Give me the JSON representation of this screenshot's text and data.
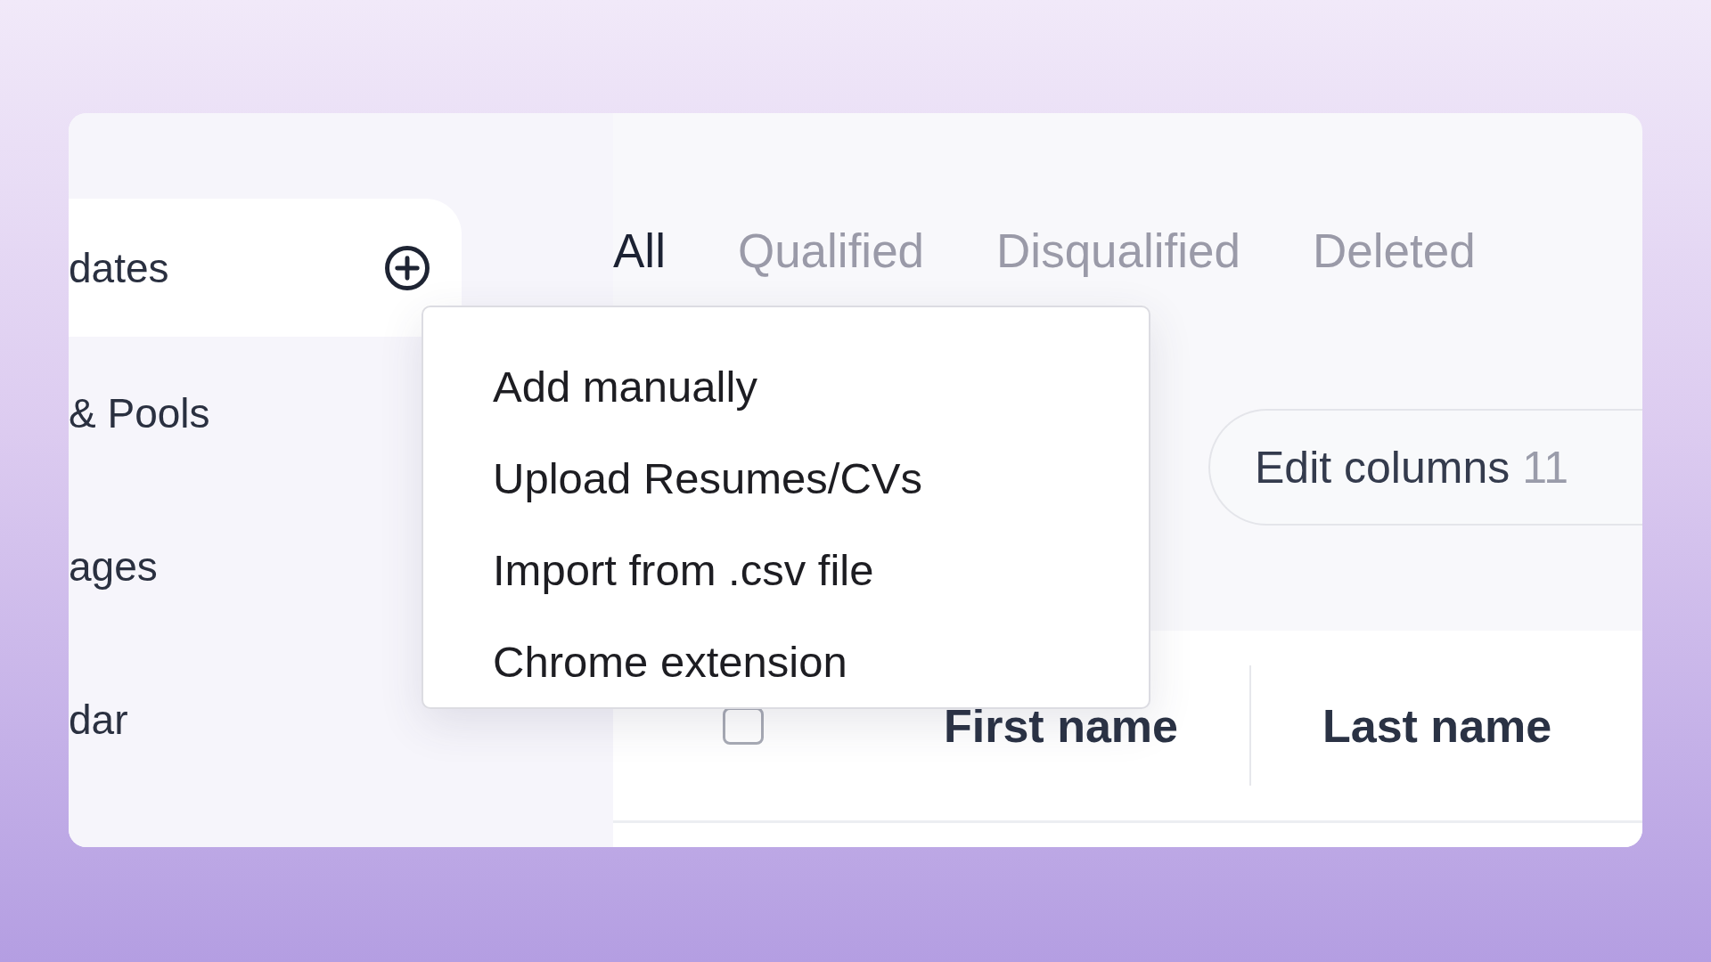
{
  "sidebar": {
    "items": [
      {
        "label": "dates",
        "selected": true
      },
      {
        "label": "& Pools",
        "selected": false
      },
      {
        "label": "ages",
        "selected": false
      },
      {
        "label": "dar",
        "selected": false
      }
    ]
  },
  "tabs": [
    {
      "label": "All",
      "selected": true
    },
    {
      "label": "Qualified",
      "selected": false
    },
    {
      "label": "Disqualified",
      "selected": false
    },
    {
      "label": "Deleted",
      "selected": false
    }
  ],
  "edit_columns": {
    "label": "Edit columns",
    "count": "11"
  },
  "table": {
    "select_all": {
      "checked": false
    },
    "columns": [
      "First name",
      "Last name"
    ]
  },
  "add_menu": {
    "items": [
      "Add manually",
      "Upload Resumes/CVs",
      "Import from .csv file",
      "Chrome extension"
    ]
  }
}
